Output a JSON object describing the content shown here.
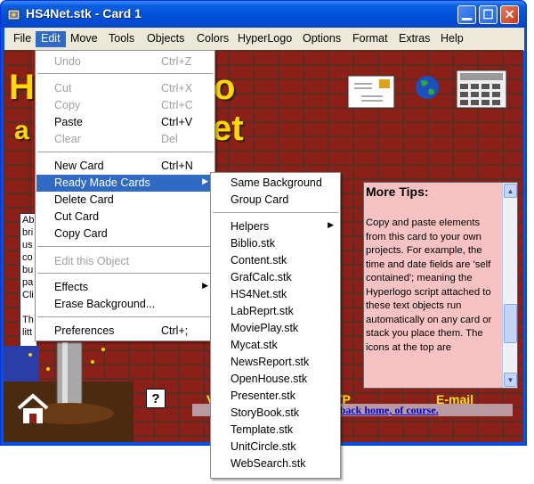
{
  "window": {
    "title": "HS4Net.stk - Card 1"
  },
  "menubar": [
    "File",
    "Edit",
    "Move",
    "Tools",
    "Objects",
    "Colors",
    "HyperLogo",
    "Options",
    "Format",
    "Extras",
    "Help"
  ],
  "edit_menu": {
    "undo": {
      "label": "Undo",
      "shortcut": "Ctrl+Z"
    },
    "cut": {
      "label": "Cut",
      "shortcut": "Ctrl+X"
    },
    "copy": {
      "label": "Copy",
      "shortcut": "Ctrl+C"
    },
    "paste": {
      "label": "Paste",
      "shortcut": "Ctrl+V"
    },
    "clear": {
      "label": "Clear",
      "shortcut": "Del"
    },
    "new_card": {
      "label": "New Card",
      "shortcut": "Ctrl+N"
    },
    "ready_made": {
      "label": "Ready Made Cards"
    },
    "delete_card": {
      "label": "Delete Card"
    },
    "cut_card": {
      "label": "Cut Card"
    },
    "copy_card": {
      "label": "Copy Card"
    },
    "edit_object": {
      "label": "Edit this Object"
    },
    "effects": {
      "label": "Effects"
    },
    "erase_bg": {
      "label": "Erase Background..."
    },
    "preferences": {
      "label": "Preferences",
      "shortcut": "Ctrl+;"
    }
  },
  "submenu": {
    "same_background": "Same Background",
    "group_card": "Group Card",
    "helpers": "Helpers",
    "stacks": [
      "Biblio.stk",
      "Content.stk",
      "GrafCalc.stk",
      "HS4Net.stk",
      "LabReprt.stk",
      "MoviePlay.stk",
      "Mycat.stk",
      "NewsReport.stk",
      "OpenHouse.stk",
      "Presenter.stk",
      "StoryBook.stk",
      "Template.stk",
      "UnitCircle.stk",
      "WebSearch.stk"
    ]
  },
  "card": {
    "title_line1": "H",
    "title_line1_end": "o",
    "title_line2": "a",
    "title_line2_end": "et",
    "left_text": [
      "Ab",
      "bri",
      "us",
      "co",
      "bu",
      "pa",
      "Cli",
      "",
      "Th",
      "litt"
    ],
    "tips_title": "More Tips:",
    "tips_body": "Copy and paste elements from this card to your own projects. For example, the time and date fields are 'self contained'; meaning the Hyperlogo script attached to these text objects run automatically on any card or stack you place them. The icons at the top are",
    "home_link": "u back home, of course.",
    "label_v": "V",
    "label_tp": "TP",
    "label_email": "E-mail",
    "help_mark": "?"
  },
  "colors": {
    "menu_highlight": "#316ac5",
    "brick": "#8a2018",
    "title_yellow": "#ffd800",
    "tips_bg": "#f8c2c2"
  }
}
